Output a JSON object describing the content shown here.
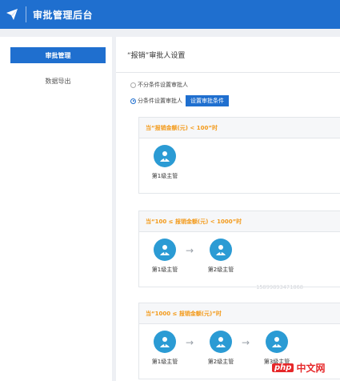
{
  "header": {
    "title": "审批管理后台",
    "bg": "#1f6fcf",
    "logo_icon": "paper-plane-icon"
  },
  "sidebar": {
    "items": [
      {
        "label": "审批管理",
        "active": true
      },
      {
        "label": "数据导出",
        "active": false
      }
    ]
  },
  "main": {
    "title": "“报销”审批人设置",
    "options": [
      {
        "label": "不分条件设置审批人",
        "checked": false
      },
      {
        "label": "分条件设置审批人",
        "checked": true
      }
    ],
    "set_condition_button": "设置审批条件",
    "conditions": [
      {
        "header": "当“报销金额(元) < 100”时",
        "approvers": [
          "第1级主管"
        ]
      },
      {
        "header": "当“100 ≤ 报销金额(元) < 1000”时",
        "approvers": [
          "第1级主管",
          "第2级主管"
        ]
      },
      {
        "header": "当“1000 ≤ 报销金额(元)”时",
        "approvers": [
          "第1级主管",
          "第2级主管",
          "第3级主管"
        ]
      }
    ],
    "arrow_glyph": "→"
  },
  "watermark_text": "15899893471868",
  "branding": {
    "badge": "php",
    "text": "中文网"
  },
  "colors": {
    "accent": "#1f6fcf",
    "condition_text": "#f39a1a",
    "avatar": "#2b9bd4"
  }
}
